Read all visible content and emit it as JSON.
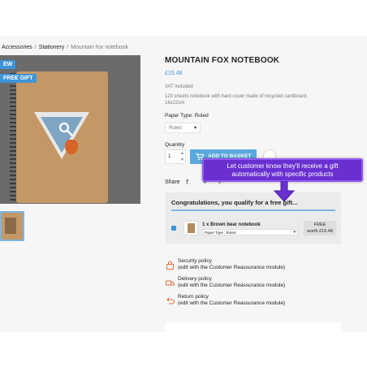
{
  "breadcrumb": {
    "items": [
      "Accessories",
      "Stationery"
    ],
    "current": "Mountain fox notebook",
    "separator": "/"
  },
  "badges": {
    "new": "EW",
    "gift": "FREE GIFT"
  },
  "product": {
    "title": "MOUNTAIN FOX NOTEBOOK",
    "price": "£15.48",
    "vat": "VAT included",
    "description": "120 sheets notebook with hard cover made of recycled cardboard. 16x22cm",
    "paper_type_label": "Paper Type: Ruled",
    "paper_type_value": "Ruled",
    "quantity_label": "Quantity",
    "quantity_value": "1",
    "add_to_basket": "ADD TO BASKET",
    "share_label": "Share"
  },
  "callout": {
    "line1": "Let customer know they'll receive a gift",
    "line2": "automatically with specific products"
  },
  "gift": {
    "title": "Congratulations, you qualify for a free gift...",
    "item_name": "1 x Brown bear notebook",
    "item_option": "Paper Type : Ruled",
    "free_label": "FREE",
    "worth_label": "worth £15.48"
  },
  "reassurance": [
    {
      "title": "Security policy",
      "subtitle": "(edit with the Customer Reassurance module)",
      "icon": "shield-icon"
    },
    {
      "title": "Delivery policy",
      "subtitle": "(edit with the Customer Reassurance module)",
      "icon": "truck-icon"
    },
    {
      "title": "Return policy",
      "subtitle": "(edit with the Customer Reassurance module)",
      "icon": "return-icon"
    }
  ],
  "colors": {
    "accent": "#3e94d6",
    "callout": "#6a2fd0"
  }
}
